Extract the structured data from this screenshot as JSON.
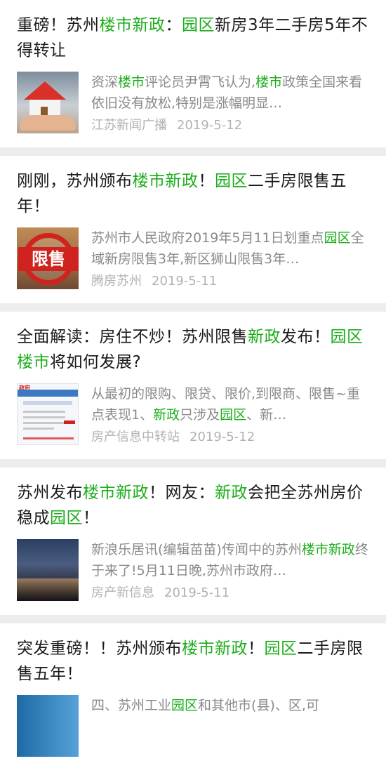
{
  "articles": [
    {
      "title": [
        {
          "t": "重磅！苏州",
          "hl": false
        },
        {
          "t": "楼市新政",
          "hl": true
        },
        {
          "t": "：",
          "hl": false
        },
        {
          "t": "园区",
          "hl": true
        },
        {
          "t": "新房3年二手房5年不得转让",
          "hl": false
        }
      ],
      "snippet": [
        {
          "t": "资深",
          "hl": false
        },
        {
          "t": "楼市",
          "hl": true
        },
        {
          "t": "评论员尹霄飞认为,",
          "hl": false
        },
        {
          "t": "楼市",
          "hl": true
        },
        {
          "t": "政策全国来看依旧没有放松,特别是涨幅明显…",
          "hl": false
        }
      ],
      "source": "江苏新闻广播",
      "date": "2019-5-12",
      "thumb_icon": "house-in-hands-image"
    },
    {
      "title": [
        {
          "t": "刚刚，苏州颁布",
          "hl": false
        },
        {
          "t": "楼市新政",
          "hl": true
        },
        {
          "t": "！",
          "hl": false
        },
        {
          "t": "园区",
          "hl": true
        },
        {
          "t": "二手房限售五年！",
          "hl": false
        }
      ],
      "snippet": [
        {
          "t": "苏州市人民政府2019年5月11日划重点",
          "hl": false
        },
        {
          "t": "园区",
          "hl": true
        },
        {
          "t": "全域新房限售3年,新区狮山限售3年…",
          "hl": false
        }
      ],
      "source": "腾房苏州",
      "date": "2019-5-11",
      "thumb_icon": "restricted-sale-image",
      "thumb_text": "限售"
    },
    {
      "title": [
        {
          "t": "全面解读：房住不炒！苏州限售",
          "hl": false
        },
        {
          "t": "新政",
          "hl": true
        },
        {
          "t": "发布！",
          "hl": false
        },
        {
          "t": "园区楼市",
          "hl": true
        },
        {
          "t": "将如何发展?",
          "hl": false
        }
      ],
      "snippet": [
        {
          "t": "从最初的限购、限贷、限价,到限商、限售~重点表现1、",
          "hl": false
        },
        {
          "t": "新政",
          "hl": true
        },
        {
          "t": "只涉及",
          "hl": false
        },
        {
          "t": "园区",
          "hl": true
        },
        {
          "t": "、新…",
          "hl": false
        }
      ],
      "source": "房产信息中转站",
      "date": "2019-5-12",
      "thumb_icon": "government-document-image",
      "thumb_text": "政府"
    },
    {
      "title": [
        {
          "t": "苏州发布",
          "hl": false
        },
        {
          "t": "楼市新政",
          "hl": true
        },
        {
          "t": "！网友：",
          "hl": false
        },
        {
          "t": "新政",
          "hl": true
        },
        {
          "t": "会把全苏州房价稳成",
          "hl": false
        },
        {
          "t": "园区",
          "hl": true
        },
        {
          "t": "！",
          "hl": false
        }
      ],
      "snippet": [
        {
          "t": "新浪乐居讯(编辑苗苗)传闻中的苏州",
          "hl": false
        },
        {
          "t": "楼市新政",
          "hl": true
        },
        {
          "t": "终于来了!5月11日晚,苏州市政府…",
          "hl": false
        }
      ],
      "source": "房产新信息",
      "date": "2019-5-11",
      "thumb_icon": "city-night-image"
    },
    {
      "title": [
        {
          "t": "突发重磅！！苏州颁布",
          "hl": false
        },
        {
          "t": "楼市新政",
          "hl": true
        },
        {
          "t": "！",
          "hl": false
        },
        {
          "t": "园区",
          "hl": true
        },
        {
          "t": "二手房限售五年！",
          "hl": false
        }
      ],
      "snippet": [
        {
          "t": "四、苏州工业",
          "hl": false
        },
        {
          "t": "园区",
          "hl": true
        },
        {
          "t": "和其他市(县)、区,可",
          "hl": false
        }
      ],
      "source": "",
      "date": "",
      "thumb_icon": "city-skyline-image"
    }
  ],
  "colors": {
    "highlight": "#1aad19",
    "title": "#1a1a1a",
    "snippet": "#8a8a8a",
    "meta": "#b2b2b2"
  }
}
